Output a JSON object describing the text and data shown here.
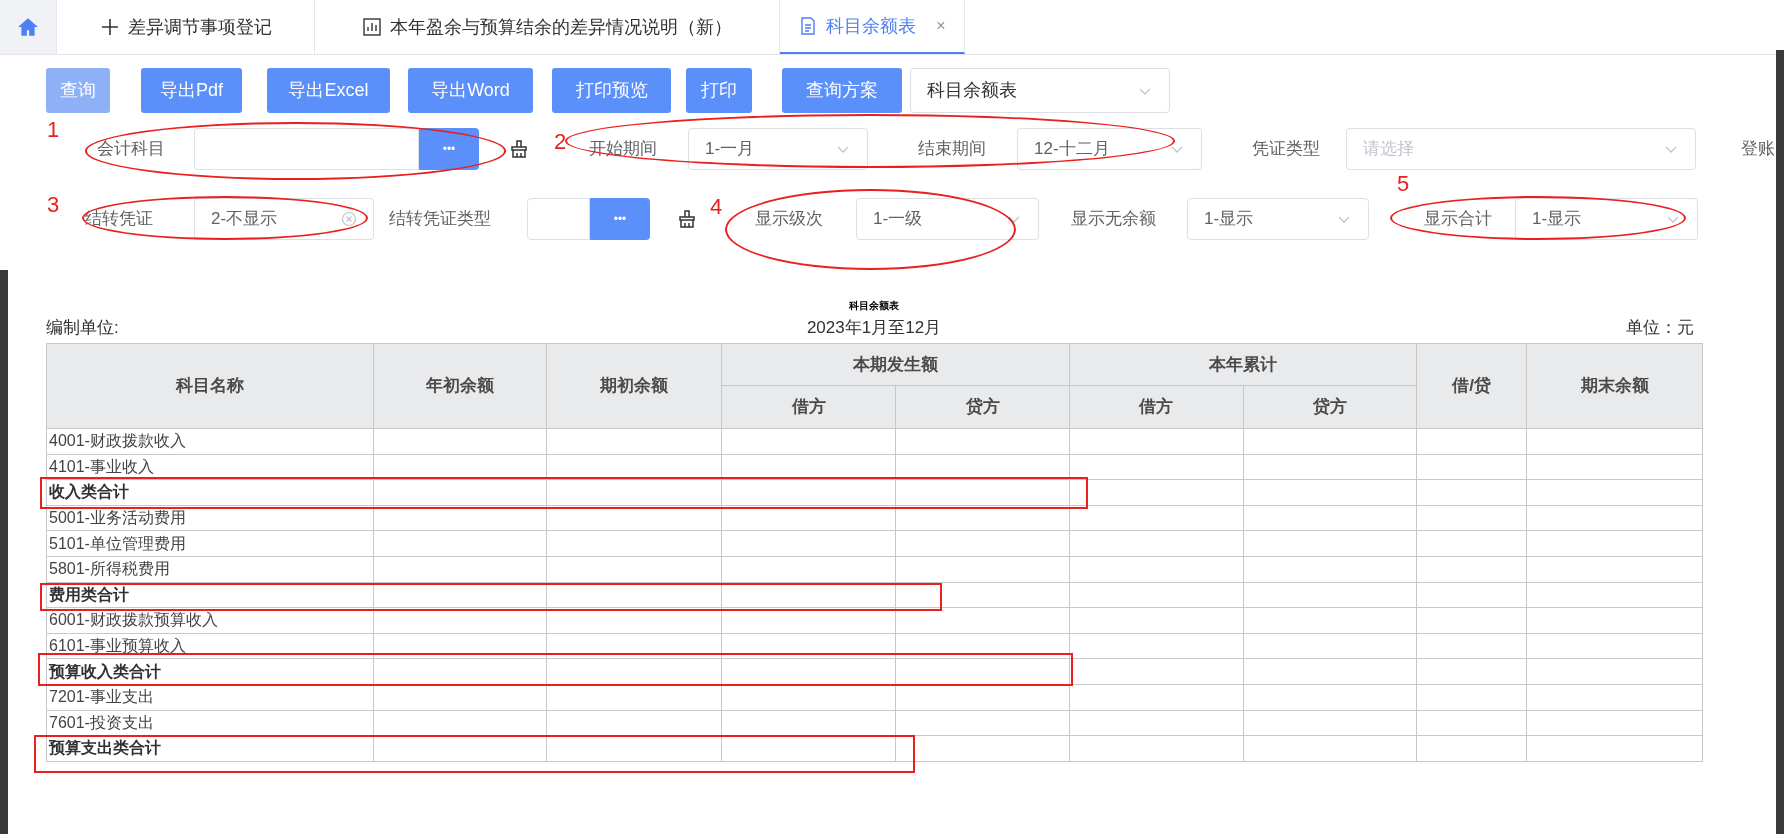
{
  "tabs": [
    {
      "label": "差异调节事项登记",
      "selected": false
    },
    {
      "label": "本年盈余与预算结余的差异情况说明（新）",
      "selected": false
    },
    {
      "label": "科目余额表",
      "selected": true,
      "close": "×"
    }
  ],
  "toolbar": {
    "buttons": [
      {
        "label": "查询",
        "disabled": true
      },
      {
        "label": "导出Pdf",
        "disabled": false
      },
      {
        "label": "导出Excel",
        "disabled": false
      },
      {
        "label": "导出Word",
        "disabled": false
      },
      {
        "label": "打印预览",
        "disabled": false
      },
      {
        "label": "打印",
        "disabled": false
      },
      {
        "label": "查询方案",
        "disabled": false
      }
    ],
    "scheme_select": {
      "value": "科目余额表"
    }
  },
  "filter_rows": [
    [
      {
        "kind": "label",
        "text": "会计科目"
      },
      {
        "kind": "picker",
        "dots": "•••"
      },
      {
        "kind": "reset"
      },
      {
        "kind": "label",
        "text": "开始期间"
      },
      {
        "kind": "select",
        "value": "1-一月"
      },
      {
        "kind": "label",
        "text": "结束期间"
      },
      {
        "kind": "select",
        "value": "12-十二月"
      },
      {
        "kind": "label",
        "text": "凭证类型"
      },
      {
        "kind": "select",
        "placeholder": "请选择"
      },
      {
        "kind": "label",
        "text": "登账"
      }
    ],
    [
      {
        "kind": "label",
        "text": "结转凭证"
      },
      {
        "kind": "select",
        "value": "2-不显示",
        "clearable": true
      },
      {
        "kind": "label",
        "text": "结转凭证类型"
      },
      {
        "kind": "picker",
        "dots": "•••"
      },
      {
        "kind": "reset"
      },
      {
        "kind": "label",
        "text": "显示级次"
      },
      {
        "kind": "select",
        "value": "1-一级"
      },
      {
        "kind": "label",
        "text": "显示无余额"
      },
      {
        "kind": "select",
        "value": "1-显示"
      },
      {
        "kind": "label",
        "text": "显示合计"
      },
      {
        "kind": "select",
        "value": "1-显示"
      }
    ]
  ],
  "report": {
    "title": "科目余额表",
    "unit_label": "编制单位:",
    "period": "2023年1月至12月",
    "currency": "单位：元",
    "columns": [
      {
        "label": "科目名称"
      },
      {
        "label": "年初余额"
      },
      {
        "label": "期初余额"
      },
      {
        "label": "本期发生额",
        "children": [
          "借方",
          "贷方"
        ]
      },
      {
        "label": "本年累计",
        "children": [
          "借方",
          "贷方"
        ]
      },
      {
        "label": "借/贷"
      },
      {
        "label": "期末余额"
      }
    ],
    "rows": [
      {
        "name": "4001-财政拨款收入",
        "kind": "item"
      },
      {
        "name": "4101-事业收入",
        "kind": "item"
      },
      {
        "name": "收入类合计",
        "kind": "total"
      },
      {
        "name": "5001-业务活动费用",
        "kind": "item"
      },
      {
        "name": "5101-单位管理费用",
        "kind": "item"
      },
      {
        "name": "5801-所得税费用",
        "kind": "item"
      },
      {
        "name": "费用类合计",
        "kind": "total"
      },
      {
        "name": "6001-财政拨款预算收入",
        "kind": "item"
      },
      {
        "name": "6101-事业预算收入",
        "kind": "item"
      },
      {
        "name": "预算收入类合计",
        "kind": "total"
      },
      {
        "name": "7201-事业支出",
        "kind": "item"
      },
      {
        "name": "7601-投资支出",
        "kind": "item"
      },
      {
        "name": "预算支出类合计",
        "kind": "total"
      }
    ]
  },
  "annotations": [
    {
      "number": "1",
      "kind": "ellipse"
    },
    {
      "number": "2",
      "kind": "ellipse"
    },
    {
      "number": "3",
      "kind": "ellipse"
    },
    {
      "number": "4",
      "kind": "ellipse"
    },
    {
      "number": "5",
      "kind": "ellipse"
    },
    {
      "kind": "rect"
    },
    {
      "kind": "rect"
    },
    {
      "kind": "rect"
    },
    {
      "kind": "rect"
    }
  ]
}
